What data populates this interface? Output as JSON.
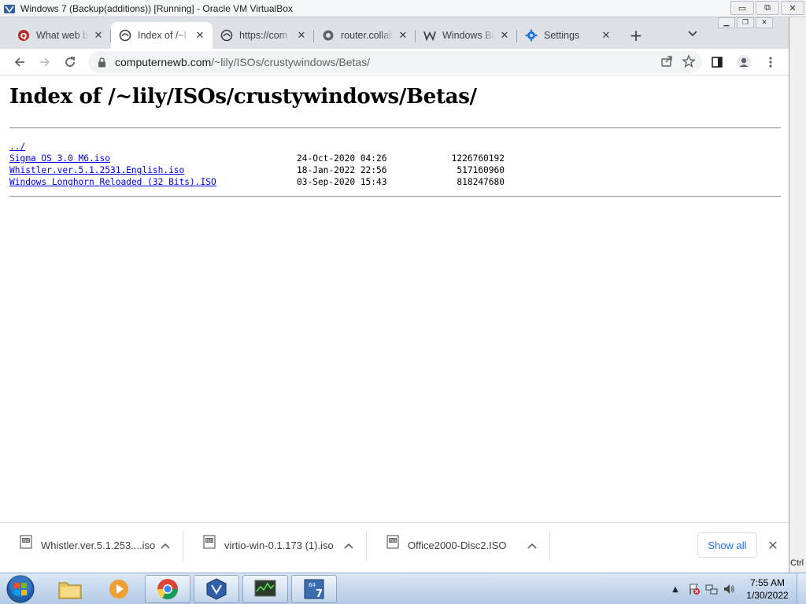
{
  "vbox": {
    "title": "Windows 7 (Backup(additions)) [Running] - Oracle VM VirtualBox",
    "controls": [
      "▭",
      "⧉",
      "✕"
    ]
  },
  "browser": {
    "tabs": [
      {
        "title": "What web b",
        "favicon": "quora-icon",
        "active": false
      },
      {
        "title": "Index of /~l",
        "favicon": "apache-index-icon",
        "active": true
      },
      {
        "title": "https://com",
        "favicon": "apache-index-icon",
        "active": false
      },
      {
        "title": "router.collab",
        "favicon": "globe-icon",
        "active": false
      },
      {
        "title": "Windows Be",
        "favicon": "wiki-w-icon",
        "active": false
      },
      {
        "title": "Settings",
        "favicon": "gear-icon",
        "active": false
      }
    ],
    "new_tab": "+",
    "url": {
      "host": "computernewb.com",
      "path": "/~lily/ISOs/crustywindows/Betas/"
    }
  },
  "page": {
    "title": "Index of /~lily/ISOs/crustywindows/Betas/",
    "parent_link": "../",
    "files": [
      {
        "name": "Sigma OS 3.0 M6.iso",
        "date": "24-Oct-2020 04:26",
        "size": "1226760192"
      },
      {
        "name": "Whistler.ver.5.1.2531.English.iso",
        "date": "18-Jan-2022 22:56",
        "size": "517160960"
      },
      {
        "name": "Windows Longhorn Reloaded (32 Bits).ISO",
        "date": "03-Sep-2020 15:43",
        "size": "818247680"
      }
    ]
  },
  "downloads": {
    "items": [
      {
        "name": "Whistler.ver.5.1.253....iso"
      },
      {
        "name": "virtio-win-0.1.173 (1).iso"
      },
      {
        "name": "Office2000-Disc2.ISO"
      }
    ],
    "show_all": "Show all",
    "close": "✕"
  },
  "vbox_side": {
    "ctrl_label": "Ctrl"
  },
  "taskbar": {
    "apps": [
      "explorer",
      "media-player",
      "chrome",
      "virtualbox",
      "task-manager",
      "win7-64-vm"
    ],
    "clock": {
      "time": "7:55 AM",
      "date": "1/30/2022"
    }
  },
  "colors": {
    "link": "#0000ee",
    "tabstrip": "#dee1e6",
    "show_all": "#1a73e8"
  }
}
